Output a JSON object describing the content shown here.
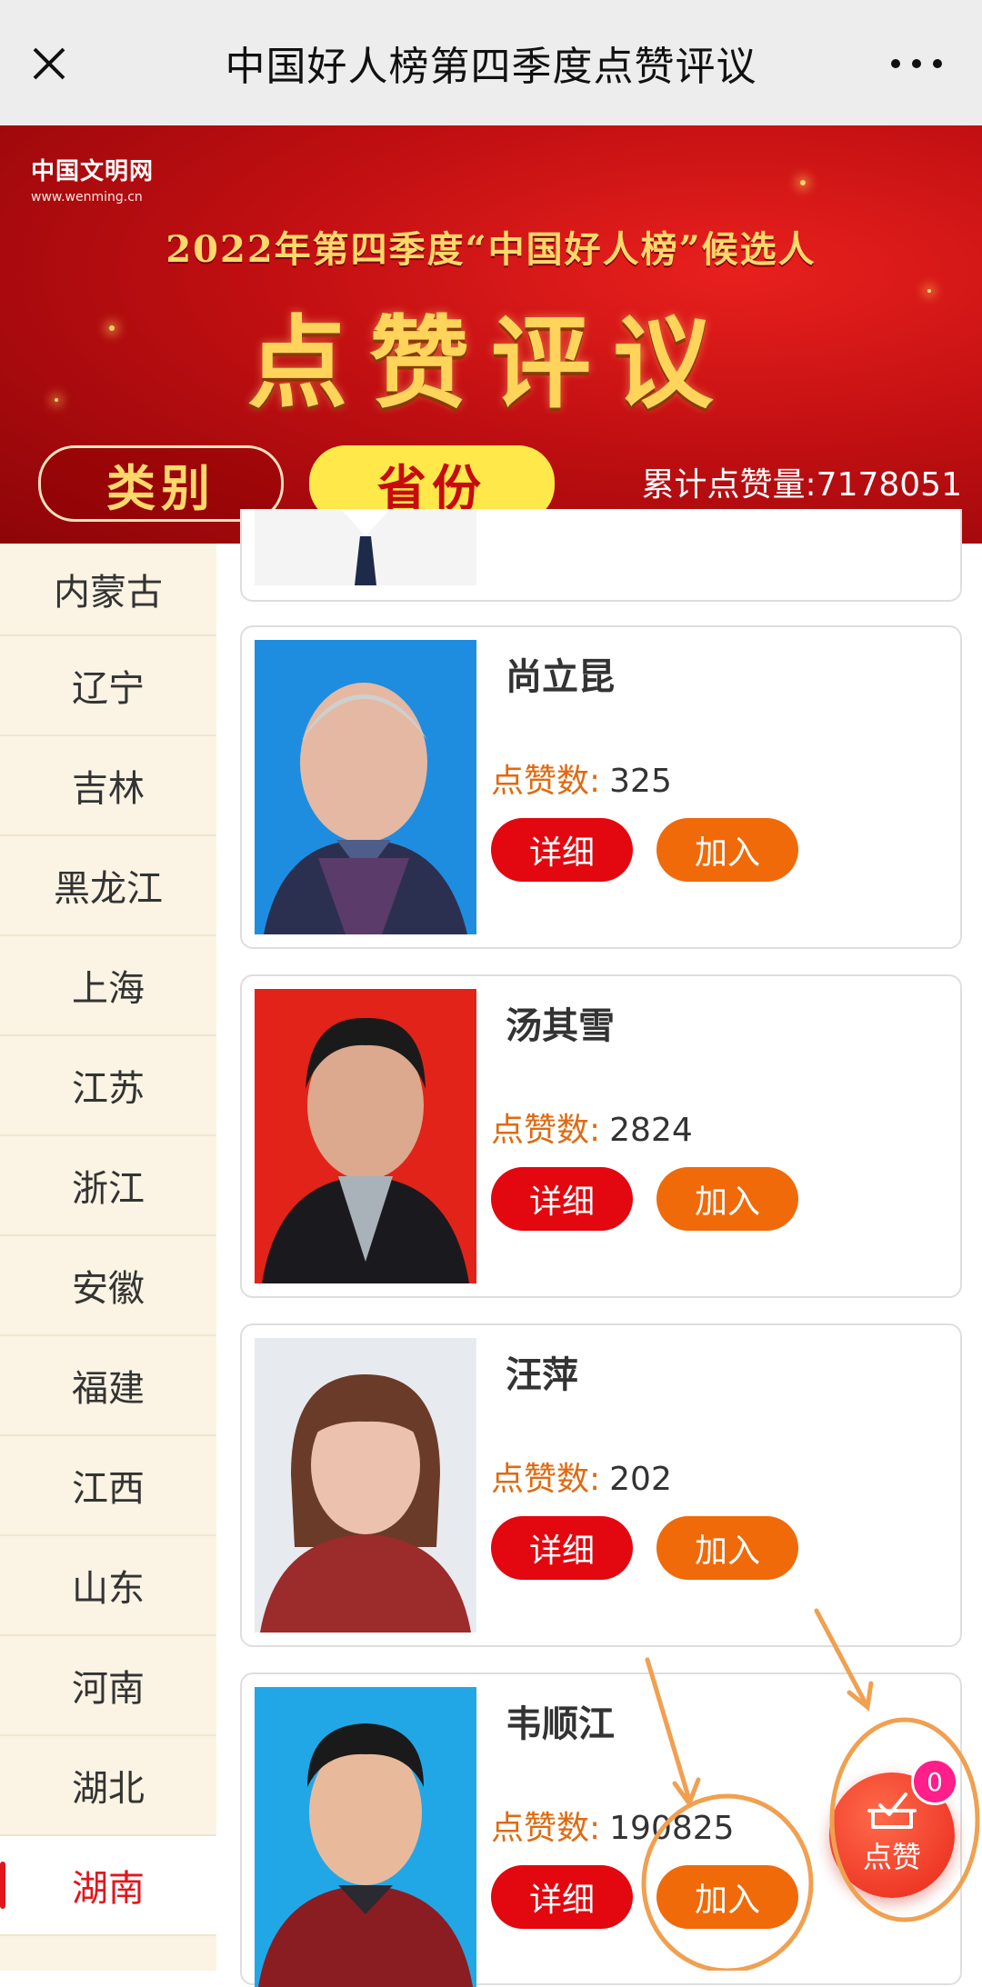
{
  "topbar": {
    "title": "中国好人榜第四季度点赞评议"
  },
  "banner": {
    "logo_cn": "中国文明网",
    "logo_en": "www.wenming.cn",
    "headline": "2022年第四季度“中国好人榜”候选人",
    "big_title": "点赞评议",
    "tab_category": "类别",
    "tab_province": "省份",
    "total_likes": "累计点赞量:7178051"
  },
  "sidebar": {
    "items": [
      {
        "label": "内蒙古"
      },
      {
        "label": "辽宁"
      },
      {
        "label": "吉林"
      },
      {
        "label": "黑龙江"
      },
      {
        "label": "上海"
      },
      {
        "label": "江苏"
      },
      {
        "label": "浙江"
      },
      {
        "label": "安徽"
      },
      {
        "label": "福建"
      },
      {
        "label": "江西"
      },
      {
        "label": "山东"
      },
      {
        "label": "河南"
      },
      {
        "label": "湖北"
      },
      {
        "label": "湖南"
      }
    ],
    "active": "湖南"
  },
  "cards": [
    {
      "name": "尚立昆",
      "likes_label": "点赞数:",
      "likes": "325",
      "detail": "详细",
      "join": "加入",
      "bg": "#1f8fe0"
    },
    {
      "name": "汤其雪",
      "likes_label": "点赞数:",
      "likes": "2824",
      "detail": "详细",
      "join": "加入",
      "bg": "#e2231a"
    },
    {
      "name": "汪萍",
      "likes_label": "点赞数:",
      "likes": "202",
      "detail": "详细",
      "join": "加入",
      "bg": "#e7ebef"
    },
    {
      "name": "韦顺江",
      "likes_label": "点赞数:",
      "likes": "190825",
      "detail": "详细",
      "join": "加入",
      "bg": "#22a7e6"
    }
  ],
  "float_like": {
    "label": "点赞",
    "count": "0"
  },
  "colors": {
    "accent_red": "#e3070f",
    "accent_orange": "#f06a0a",
    "annotation": "#f0a050"
  }
}
